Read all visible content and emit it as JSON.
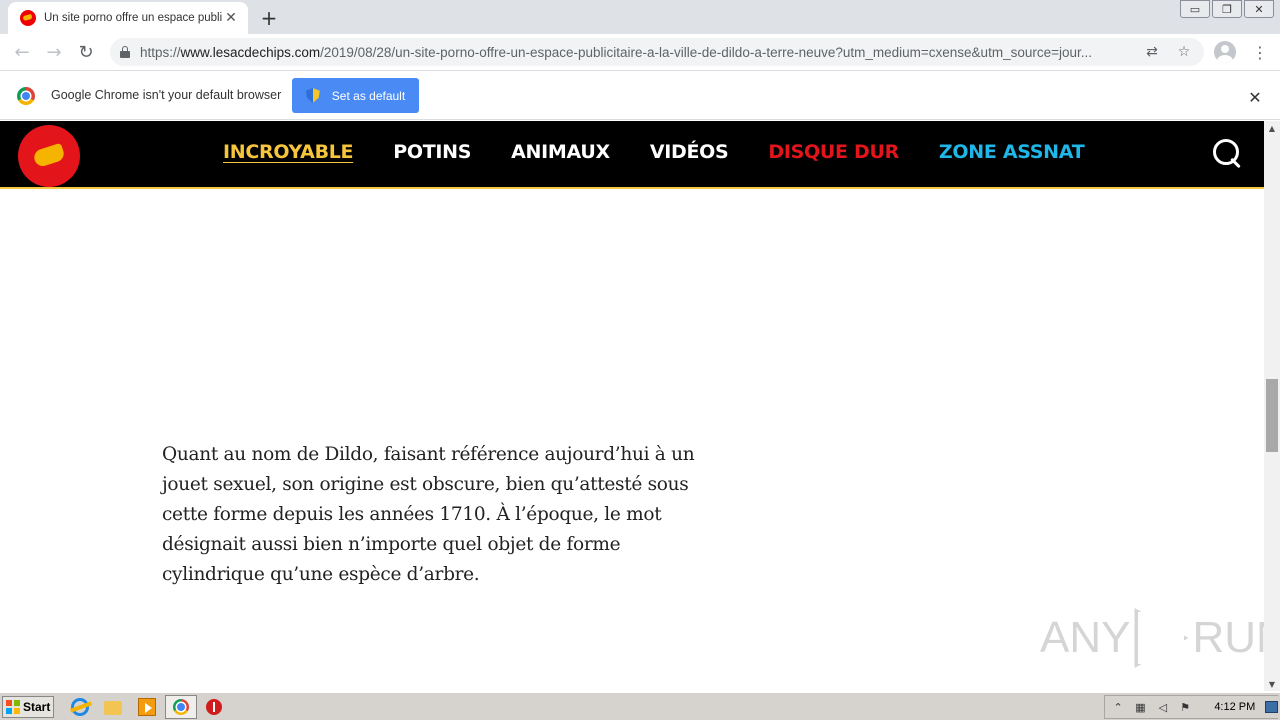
{
  "browser": {
    "tab_title": "Un site porno offre un espace publicitaire",
    "tab_close": "✕",
    "new_tab": "+",
    "window_controls": [
      "▭",
      "❐",
      "✕"
    ],
    "back": "←",
    "forward": "→",
    "reload": "↻",
    "url_scheme": "https://",
    "url_host": "www.lesacdechips.com",
    "url_path": "/2019/08/28/un-site-porno-offre-un-espace-publicitaire-a-la-ville-de-dildo-a-terre-neuve?utm_medium=cxense&utm_source=jour...",
    "translate_icon": "⇄",
    "bookmark_icon": "☆",
    "menu_icon": "⋮"
  },
  "infobar": {
    "message": "Google Chrome isn't your default browser",
    "button_label": "Set as default",
    "close": "✕"
  },
  "site": {
    "nav": [
      {
        "label": "INCROYABLE"
      },
      {
        "label": "POTINS"
      },
      {
        "label": "ANIMAUX"
      },
      {
        "label": "VIDÉOS"
      },
      {
        "label": "DISQUE DUR"
      },
      {
        "label": "ZONE ASSNAT"
      }
    ]
  },
  "article": {
    "paragraph": "Quant au nom de Dildo, faisant référence aujourd’hui à un jouet sexuel, son origine est obscure, bien qu’attesté sous cette forme depuis les années 1710. À l’époque, le mot désignait aussi bien n’importe quel objet de forme cylindrique qu’une espèce d’arbre."
  },
  "watermark": {
    "left": "ANY",
    "right": "RUN"
  },
  "scrollbar": {
    "up": "▲",
    "down": "▼",
    "position": 0.52
  },
  "taskbar": {
    "start_label": "Start",
    "tray_up": "⌃",
    "clock": "4:12 PM"
  },
  "colors": {
    "nav_yellow": "#f5c53b",
    "nav_red": "#e3151b",
    "nav_cyan": "#1fb6e8",
    "header_bg": "#000000",
    "chrome_blue_button": "#4a8af4"
  }
}
